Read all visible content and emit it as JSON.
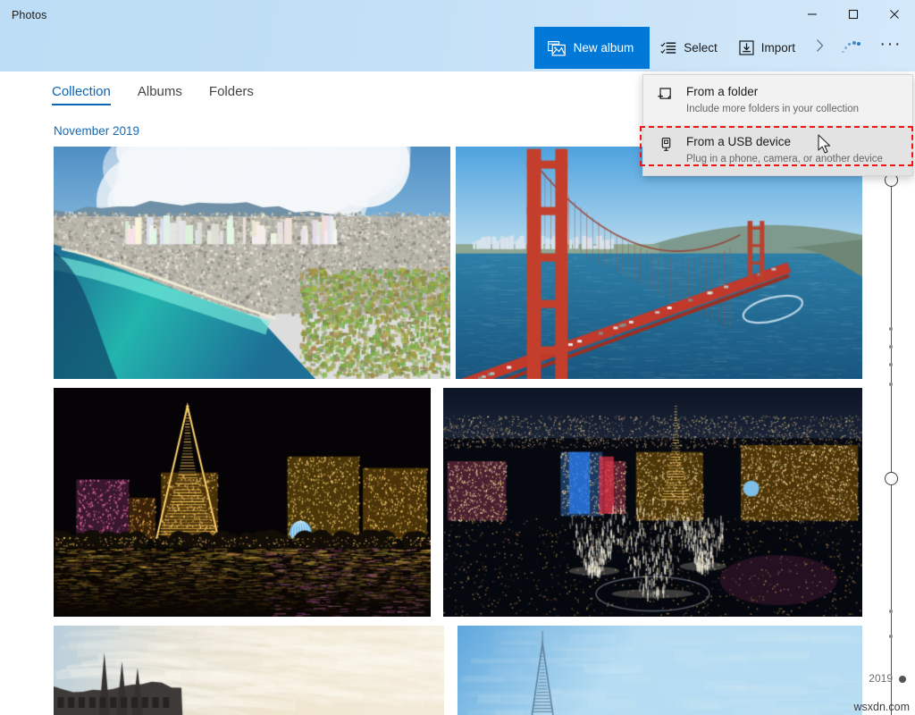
{
  "window": {
    "app_title": "Photos",
    "controls": [
      {
        "name": "minimize",
        "glyph": "minimize-icon"
      },
      {
        "name": "maximize",
        "glyph": "maximize-icon"
      },
      {
        "name": "close",
        "glyph": "close-icon"
      }
    ]
  },
  "toolbar": {
    "new_album_label": "New album",
    "new_album_icon": "new-album-icon",
    "select_label": "Select",
    "select_icon": "select-checklist-icon",
    "import_label": "Import",
    "import_icon": "import-tray-icon",
    "chevron_icon": "chevron-right-icon",
    "spinner_icon": "sync-spinner-icon",
    "overflow_label": "···",
    "accent_color": "#0078d7"
  },
  "pivot": {
    "tabs": [
      {
        "label": "Collection",
        "active": true
      },
      {
        "label": "Albums",
        "active": false
      },
      {
        "label": "Folders",
        "active": false
      }
    ],
    "active_color": "#0a65b5"
  },
  "content": {
    "date_header": "November 2019",
    "photos": [
      {
        "name": "photo-honolulu-aerial",
        "alt": "Aerial view of Honolulu coastline with turquoise water and clouds"
      },
      {
        "name": "photo-golden-gate-bridge",
        "alt": "Golden Gate Bridge from above on a clear blue day"
      },
      {
        "name": "photo-las-vegas-strip-night",
        "alt": "Las Vegas strip at night with Paris hotel Eiffel Tower reflected in water"
      },
      {
        "name": "photo-bellagio-fountains",
        "alt": "Aerial night view of Bellagio fountains on the Las Vegas strip"
      },
      {
        "name": "photo-paris-rooftops-sky",
        "alt": "Paris rooftops under a pale cloudy sky"
      },
      {
        "name": "photo-eiffel-tower-blue-sky",
        "alt": "Eiffel tower against a clear blue sky"
      }
    ]
  },
  "scrubber": {
    "year_label": "2019",
    "handle_name": "timeline-handle",
    "dot_count": 6
  },
  "import_menu": {
    "items": [
      {
        "title": "From a folder",
        "subtitle": "Include more folders in your collection",
        "icon": "folder-add-icon",
        "highlighted": false
      },
      {
        "title": "From a USB device",
        "subtitle": "Plug in a phone, camera, or another device",
        "icon": "usb-device-icon",
        "highlighted": true
      }
    ],
    "highlight_box_color": "#f01414"
  },
  "watermark": {
    "text": "wsxdn.com"
  }
}
